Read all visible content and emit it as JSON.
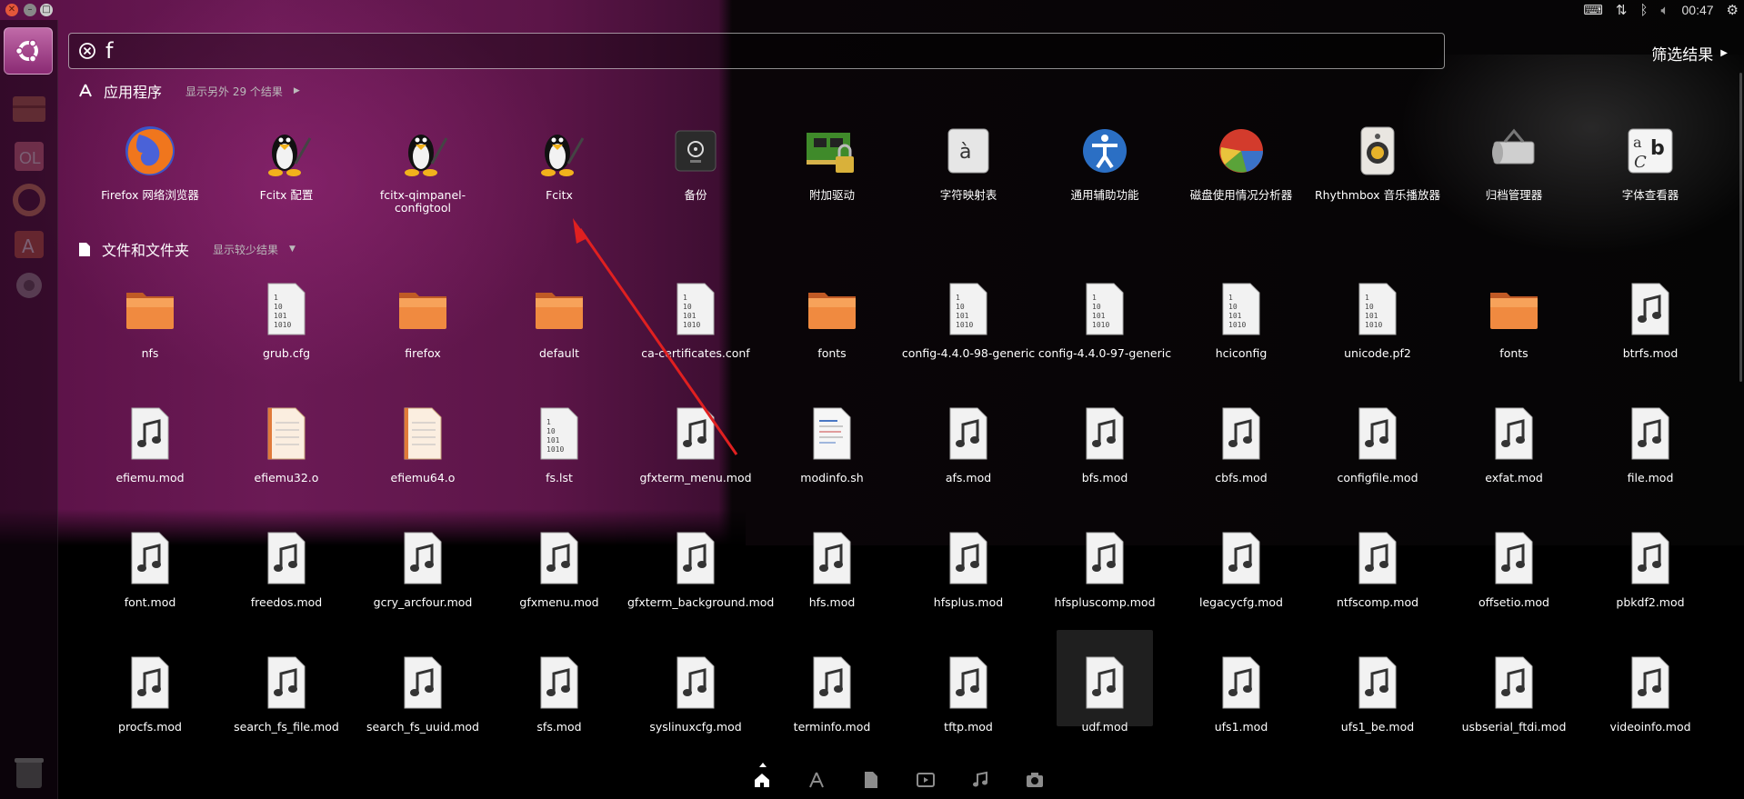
{
  "search": {
    "query": "f",
    "filter_label": "筛选结果"
  },
  "topbar": {
    "clock": "00:47"
  },
  "apps_section": {
    "title": "应用程序",
    "more": "显示另外 29 个结果"
  },
  "files_section": {
    "title": "文件和文件夹",
    "more": "显示较少结果"
  },
  "apps": [
    {
      "label": "Firefox 网络浏览器",
      "icon": "firefox-icon"
    },
    {
      "label": "Fcitx 配置",
      "icon": "tux-icon"
    },
    {
      "label": "fcitx-qimpanel-configtool",
      "icon": "tux-icon"
    },
    {
      "label": "Fcitx",
      "icon": "tux-icon"
    },
    {
      "label": "备份",
      "icon": "backup-safe-icon"
    },
    {
      "label": "附加驱动",
      "icon": "driver-chip-icon"
    },
    {
      "label": "字符映射表",
      "icon": "charmap-key-icon"
    },
    {
      "label": "通用辅助功能",
      "icon": "accessibility-icon"
    },
    {
      "label": "磁盘使用情况分析器",
      "icon": "disk-usage-pie-icon"
    },
    {
      "label": "Rhythmbox 音乐播放器",
      "icon": "rhythmbox-speaker-icon"
    },
    {
      "label": "归档管理器",
      "icon": "archive-manager-icon"
    },
    {
      "label": "字体查看器",
      "icon": "font-viewer-icon"
    }
  ],
  "files": [
    [
      {
        "label": "nfs",
        "icon": "folder-icon"
      },
      {
        "label": "grub.cfg",
        "icon": "binary-file-icon"
      },
      {
        "label": "firefox",
        "icon": "folder-icon"
      },
      {
        "label": "default",
        "icon": "folder-icon"
      },
      {
        "label": "ca-certificates.conf",
        "icon": "binary-file-icon"
      },
      {
        "label": "fonts",
        "icon": "folder-icon"
      },
      {
        "label": "config-4.4.0-98-generic",
        "icon": "binary-file-icon"
      },
      {
        "label": "config-4.4.0-97-generic",
        "icon": "binary-file-icon"
      },
      {
        "label": "hciconfig",
        "icon": "binary-file-icon"
      },
      {
        "label": "unicode.pf2",
        "icon": "binary-file-icon"
      },
      {
        "label": "fonts",
        "icon": "folder-icon"
      },
      {
        "label": "btrfs.mod",
        "icon": "audio-file-icon"
      }
    ],
    [
      {
        "label": "efiemu.mod",
        "icon": "audio-file-icon"
      },
      {
        "label": "efiemu32.o",
        "icon": "text-file-icon"
      },
      {
        "label": "efiemu64.o",
        "icon": "text-file-icon"
      },
      {
        "label": "fs.lst",
        "icon": "binary-file-icon"
      },
      {
        "label": "gfxterm_menu.mod",
        "icon": "audio-file-icon"
      },
      {
        "label": "modinfo.sh",
        "icon": "script-file-icon"
      },
      {
        "label": "afs.mod",
        "icon": "audio-file-icon"
      },
      {
        "label": "bfs.mod",
        "icon": "audio-file-icon"
      },
      {
        "label": "cbfs.mod",
        "icon": "audio-file-icon"
      },
      {
        "label": "configfile.mod",
        "icon": "audio-file-icon"
      },
      {
        "label": "exfat.mod",
        "icon": "audio-file-icon"
      },
      {
        "label": "file.mod",
        "icon": "audio-file-icon"
      }
    ],
    [
      {
        "label": "font.mod",
        "icon": "audio-file-icon"
      },
      {
        "label": "freedos.mod",
        "icon": "audio-file-icon"
      },
      {
        "label": "gcry_arcfour.mod",
        "icon": "audio-file-icon"
      },
      {
        "label": "gfxmenu.mod",
        "icon": "audio-file-icon"
      },
      {
        "label": "gfxterm_background.mod",
        "icon": "audio-file-icon"
      },
      {
        "label": "hfs.mod",
        "icon": "audio-file-icon"
      },
      {
        "label": "hfsplus.mod",
        "icon": "audio-file-icon"
      },
      {
        "label": "hfspluscomp.mod",
        "icon": "audio-file-icon"
      },
      {
        "label": "legacycfg.mod",
        "icon": "audio-file-icon"
      },
      {
        "label": "ntfscomp.mod",
        "icon": "audio-file-icon"
      },
      {
        "label": "offsetio.mod",
        "icon": "audio-file-icon"
      },
      {
        "label": "pbkdf2.mod",
        "icon": "audio-file-icon"
      }
    ],
    [
      {
        "label": "procfs.mod",
        "icon": "audio-file-icon"
      },
      {
        "label": "search_fs_file.mod",
        "icon": "audio-file-icon"
      },
      {
        "label": "search_fs_uuid.mod",
        "icon": "audio-file-icon"
      },
      {
        "label": "sfs.mod",
        "icon": "audio-file-icon"
      },
      {
        "label": "syslinuxcfg.mod",
        "icon": "audio-file-icon"
      },
      {
        "label": "terminfo.mod",
        "icon": "audio-file-icon"
      },
      {
        "label": "tftp.mod",
        "icon": "audio-file-icon"
      },
      {
        "label": "udf.mod",
        "icon": "audio-file-icon",
        "selected": true
      },
      {
        "label": "ufs1.mod",
        "icon": "audio-file-icon"
      },
      {
        "label": "ufs1_be.mod",
        "icon": "audio-file-icon"
      },
      {
        "label": "usbserial_ftdi.mod",
        "icon": "audio-file-icon"
      },
      {
        "label": "videoinfo.mod",
        "icon": "audio-file-icon"
      }
    ]
  ],
  "lenses": [
    "home-lens-icon",
    "applications-lens-icon",
    "files-lens-icon",
    "video-lens-icon",
    "music-lens-icon",
    "photo-lens-icon"
  ],
  "colors": {
    "accent": "#8a2a73",
    "folder": "#e8773a",
    "annotation_arrow": "#e02020"
  }
}
